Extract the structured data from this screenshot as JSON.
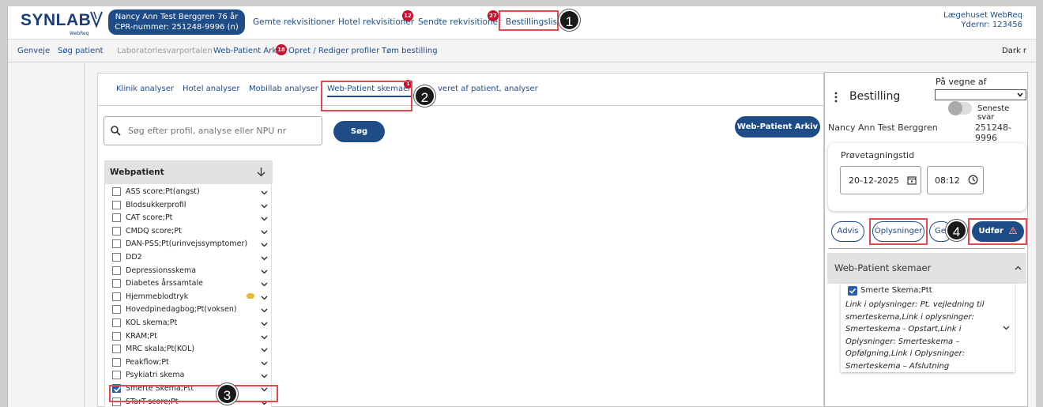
{
  "topbar": {
    "logo_text": "SYNLAB",
    "logo_sub": "WebReq",
    "patient_name": "Nancy Ann Test Berggren 76 år",
    "patient_cpr": "CPR-nummer: 251248-9996 (n)",
    "nav": [
      {
        "label": "Gemte rekvisitioner"
      },
      {
        "label": "Hotel rekvisitioner",
        "badge": "12"
      },
      {
        "label": "Sendte rekvisitioner",
        "badge": "27"
      },
      {
        "label": "Bestillingsliste"
      }
    ],
    "clinic_name": "Lægehuset WebReq",
    "ydernr": "Ydernr: 123456"
  },
  "subbar": {
    "items": [
      "Genveje",
      "Søg patient",
      "Laboratoriesvarportalen",
      "Web-Patient Arkiv",
      "Opret / Rediger profiler",
      "Tøm bestilling"
    ],
    "arkiv_badge": "18",
    "dark_label": "Dark r"
  },
  "tabs": [
    {
      "label": "Klinik analyser"
    },
    {
      "label": "Hotel analyser"
    },
    {
      "label": "Mobillab analyser"
    },
    {
      "label": "Web-Patient skemaer"
    },
    {
      "label": "veret af patient, analyser"
    }
  ],
  "tab_badge": "1",
  "search": {
    "placeholder": "Søg efter profil, analyse eller NPU nr",
    "button": "Søg",
    "arkiv_button": "Web-Patient Arkiv"
  },
  "list": {
    "header": "Webpatient",
    "items": [
      {
        "label": "ASS score;Pt(angst)",
        "checked": false
      },
      {
        "label": "Blodsukkerprofil",
        "checked": false
      },
      {
        "label": "CAT score;Pt",
        "checked": false
      },
      {
        "label": "CMDQ score;Pt",
        "checked": false
      },
      {
        "label": "DAN-PSS;Pt(urinvejssymptomer)",
        "checked": false
      },
      {
        "label": "DD2",
        "checked": false
      },
      {
        "label": "Depressionsskema",
        "checked": false
      },
      {
        "label": "Diabetes årssamtale",
        "checked": false
      },
      {
        "label": "Hjemmeblodtryk",
        "checked": false,
        "comment": true
      },
      {
        "label": "Hovedpinedagbog;Pt(voksen)",
        "checked": false
      },
      {
        "label": "KOL skema;Pt",
        "checked": false
      },
      {
        "label": "KRAM;Pt",
        "checked": false
      },
      {
        "label": "MRC skala;Pt(KOL)",
        "checked": false
      },
      {
        "label": "Peakflow;Pt",
        "checked": false
      },
      {
        "label": "Psykiatri skema",
        "checked": false
      },
      {
        "label": "Smerte Skema;Ptt",
        "checked": true
      },
      {
        "label": "STarT-score;Pt",
        "checked": false
      }
    ]
  },
  "order": {
    "title": "Bestilling",
    "on_behalf_label": "På vegne af",
    "on_behalf_value": "",
    "latest_label": "Seneste svar",
    "patient_name": "Nancy Ann Test Berggren",
    "patient_cpr": "251248-9996",
    "sample_time_label": "Prøvetagningstid",
    "date": "20-12-2025",
    "time": "08:12",
    "buttons": {
      "advis": "Advis",
      "oplysninger": "Oplysninger",
      "gem": "Ge",
      "udfor": "Udfør"
    },
    "section_title": "Web-Patient skemaer",
    "selected_item": "Smerte Skema;Ptt",
    "selected_info": "Link i oplysninger: Pt. vejledning til smerteskema,Link i oplysninger: Smerteskema - Opstart,Link i Oplysninger: Smerteskema – Opfølgning,Link i Oplysninger: Smerteskema – Afslutning"
  },
  "annotations": [
    "1",
    "2",
    "3",
    "4"
  ],
  "colors": {
    "brand": "#1d4c86",
    "highlight": "#e5484d",
    "badge": "#c8102e"
  }
}
